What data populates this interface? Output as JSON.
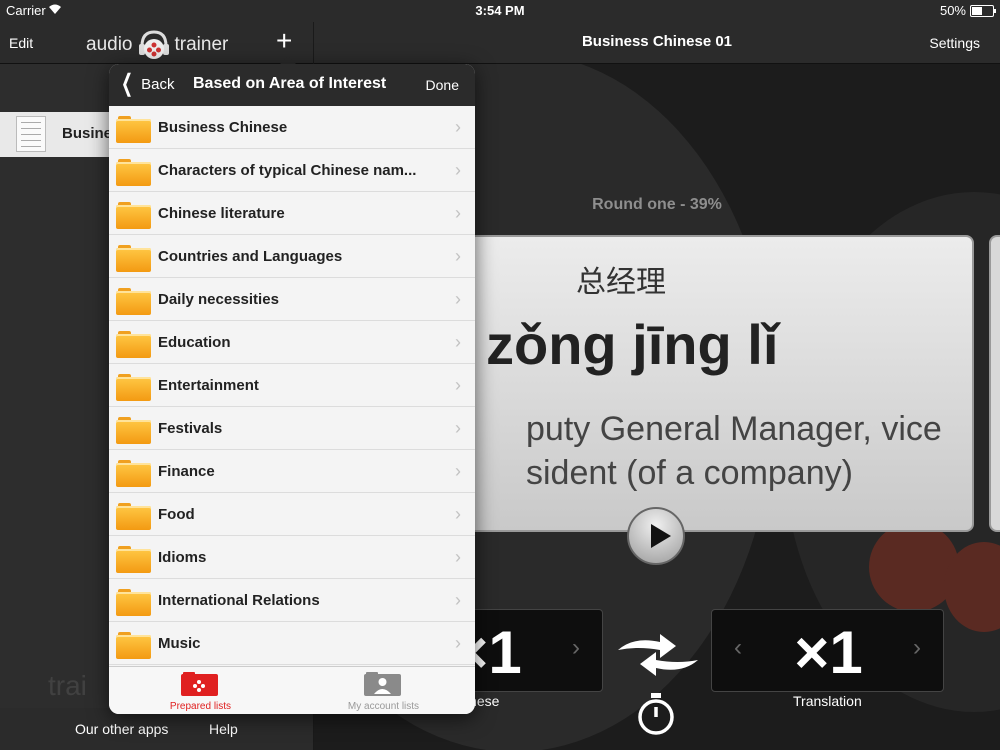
{
  "status_bar": {
    "carrier": "Carrier",
    "time": "3:54 PM",
    "battery": "50%",
    "battery_level": 0.5
  },
  "left_panel": {
    "edit_label": "Edit",
    "logo_left": "audio",
    "logo_right": "trainer",
    "add_label": "+",
    "list_item_label": "Busine",
    "background_word": "trai",
    "footer": {
      "other_apps": "Our other apps",
      "help": "Help"
    }
  },
  "main": {
    "title": "Business Chinese 01",
    "settings_label": "Settings",
    "round_text": "Round one - 39%",
    "card": {
      "hanzi": "总经理",
      "pinyin": "zǒng jīng lǐ",
      "meaning": "puty General Manager, vice sident (of a company)"
    },
    "left_counter": {
      "value": "×1",
      "label": "inese"
    },
    "right_counter": {
      "value": "×1",
      "label": "Translation"
    }
  },
  "popover": {
    "back_label": "Back",
    "title": "Based on Area of Interest",
    "done_label": "Done",
    "items": [
      "Business Chinese",
      "Characters of typical Chinese nam...",
      "Chinese literature",
      "Countries and Languages",
      "Daily necessities",
      "Education",
      "Entertainment",
      "Festivals",
      "Finance",
      "Food",
      "Idioms",
      "International Relations",
      "Music"
    ],
    "tabs": [
      {
        "label": "Prepared lists",
        "active": true,
        "color": "#e02020"
      },
      {
        "label": "My account lists",
        "active": false,
        "color": "#999999"
      }
    ]
  }
}
